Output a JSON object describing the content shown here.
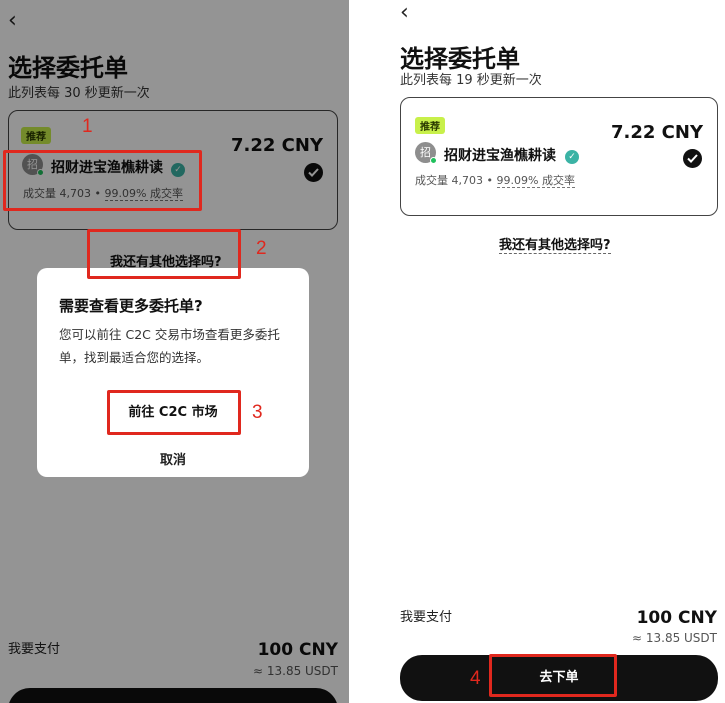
{
  "left": {
    "back_icon": "chevron-left-icon",
    "title": "选择委托单",
    "subtitle": "此列表每 30 秒更新一次",
    "card": {
      "badge": "推荐",
      "avatar_char": "招",
      "merchant": "招财进宝渔樵耕读",
      "volume": "成交量 4,703",
      "separator": "•",
      "rate": "99.09% 成交率",
      "price": "7.22 CNY"
    },
    "other_options": "我还有其他选择吗?",
    "pay_label": "我要支付",
    "pay_amount": "100 CNY",
    "pay_usdt": "≈ 13.85 USDT",
    "dialog": {
      "title": "需要查看更多委托单?",
      "body": "您可以前往 C2C 交易市场查看更多委托单，找到最适合您的选择。",
      "go_button": "前往 C2C 市场",
      "cancel_button": "取消"
    }
  },
  "right": {
    "back_icon": "chevron-left-icon",
    "title": "选择委托单",
    "subtitle": "此列表每 19 秒更新一次",
    "card": {
      "badge": "推荐",
      "avatar_char": "招",
      "merchant": "招财进宝渔樵耕读",
      "volume": "成交量 4,703",
      "separator": "•",
      "rate": "99.09% 成交率",
      "price": "7.22 CNY"
    },
    "other_options": "我还有其他选择吗?",
    "pay_label": "我要支付",
    "pay_amount": "100 CNY",
    "pay_usdt": "≈ 13.85 USDT",
    "order_button": "去下单"
  },
  "annotations": {
    "color": "#e0281e",
    "steps": [
      "1",
      "2",
      "3",
      "4"
    ]
  }
}
